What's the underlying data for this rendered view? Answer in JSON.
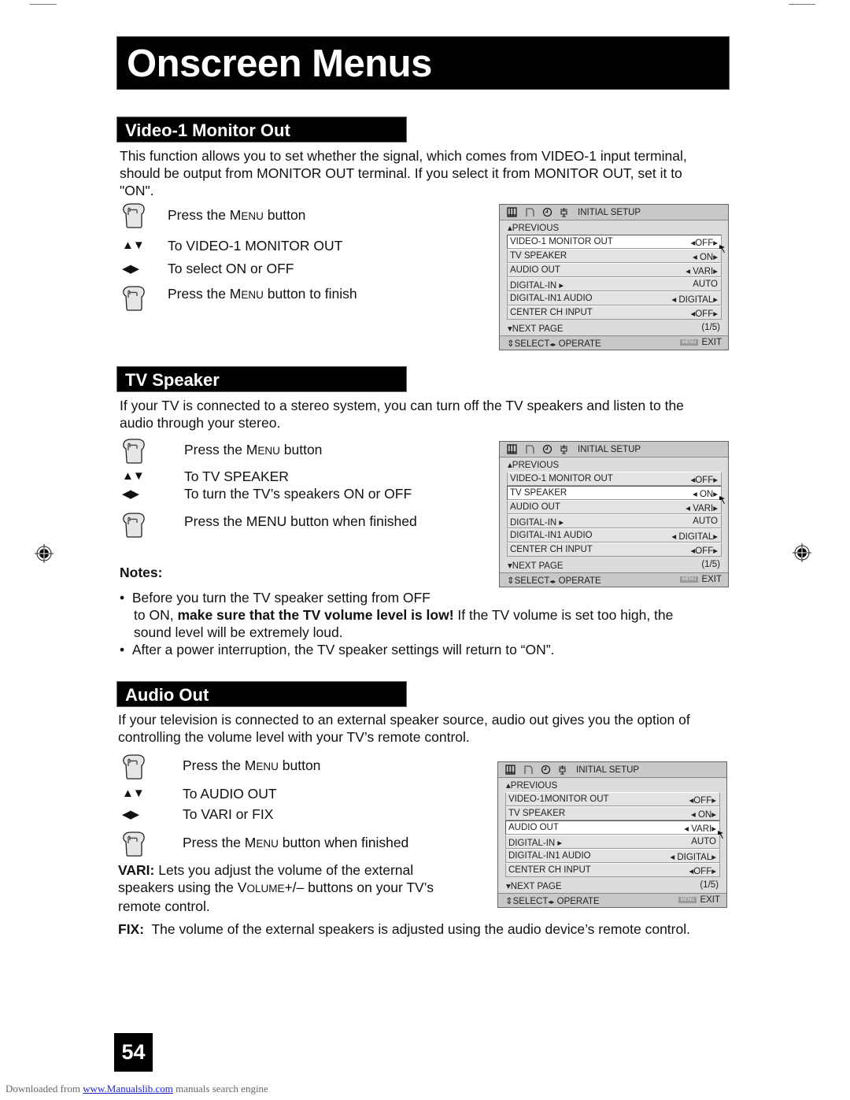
{
  "page_title": "Onscreen Menus",
  "page_number": "54",
  "footer": {
    "prefix": "Downloaded from ",
    "link_text": "www.Manualslib.com",
    "suffix": " manuals search engine"
  },
  "sections": [
    {
      "heading": "Video-1 Monitor Out",
      "intro_lines": [
        "This function allows you to set whether the signal, which comes from VIDEO-1 input terminal,",
        "should be output from MONITOR OUT terminal.  If you select it from MONITOR OUT, set it to",
        "\"ON\"."
      ],
      "steps": [
        {
          "icon": "hand-press-icon",
          "text_pre": "Press the M",
          "text_sc": "ENU",
          "text_post": " button"
        },
        {
          "icon": "up-down-arrows-icon",
          "text_pre": "To VIDEO-1 MONITOR OUT",
          "text_sc": "",
          "text_post": ""
        },
        {
          "icon": "left-right-arrows-icon",
          "text_pre": "To select ON or OFF",
          "text_sc": "",
          "text_post": ""
        },
        {
          "icon": "hand-press-icon",
          "text_pre": "Press the M",
          "text_sc": "ENU",
          "text_post": " button to finish"
        }
      ]
    },
    {
      "heading": "TV Speaker",
      "intro_lines": [
        "If your TV is connected to a stereo system, you can turn off the TV speakers and listen to the",
        "audio through your stereo."
      ],
      "steps": [
        {
          "icon": "hand-press-icon",
          "text_pre": "Press the M",
          "text_sc": "ENU",
          "text_post": " button"
        },
        {
          "icon": "up-down-arrows-icon",
          "text_pre": "To TV SPEAKER",
          "text_sc": "",
          "text_post": ""
        },
        {
          "icon": "left-right-arrows-icon",
          "text_pre": "To turn the TV’s speakers ON or OFF",
          "text_sc": "",
          "text_post": ""
        },
        {
          "icon": "hand-press-icon",
          "text_pre": "Press the MENU button when finished",
          "text_sc": "",
          "text_post": ""
        }
      ],
      "notes_label": "Notes:",
      "notes": [
        {
          "line1": "Before you turn the TV speaker setting from OFF",
          "line2_pre": "to ON, ",
          "line2_bold": "make sure that the TV volume level is low!",
          "line2_post": " If the TV volume is set too high, the",
          "line3": "sound level will be extremely loud."
        },
        {
          "line1": "After a power interruption, the TV speaker settings will return to “ON”."
        }
      ]
    },
    {
      "heading": "Audio Out",
      "intro_lines": [
        "If your television is connected to an external speaker source, audio out gives you the option of",
        "controlling the volume level with your TV’s remote control."
      ],
      "steps": [
        {
          "icon": "hand-press-icon",
          "text_pre": "Press the M",
          "text_sc": "ENU",
          "text_post": " button"
        },
        {
          "icon": "up-down-arrows-icon",
          "text_pre": "To AUDIO OUT",
          "text_sc": "",
          "text_post": ""
        },
        {
          "icon": "left-right-arrows-icon",
          "text_pre": "To VARI or FIX",
          "text_sc": "",
          "text_post": ""
        },
        {
          "icon": "hand-press-icon",
          "text_pre": "Press the M",
          "text_sc": "ENU",
          "text_post": " button when finished"
        }
      ],
      "vari": {
        "label": "VARI:",
        "line1": " Lets you adjust the volume of the external",
        "line2_pre": "speakers using the V",
        "line2_sc": "OLUME",
        "line2_post": "+/– buttons on your TV’s",
        "line3": "remote control."
      },
      "fix": {
        "label": "FIX:",
        "text": "  The volume of the external speakers is adjusted using the audio device’s remote control."
      }
    }
  ],
  "osd_menus": [
    {
      "title": "INITIAL SETUP",
      "previous": "PREVIOUS",
      "selected_index": 0,
      "items": [
        {
          "label": "VIDEO-1 MONITOR OUT",
          "value": "◂OFF▸"
        },
        {
          "label": "TV SPEAKER",
          "value": "◂ ON▸"
        },
        {
          "label": "AUDIO OUT",
          "value": "◂ VARI▸"
        },
        {
          "label": "DIGITAL-IN ▸",
          "value": "AUTO "
        },
        {
          "label": "DIGITAL-IN1 AUDIO",
          "value": "◂ DIGITAL▸"
        },
        {
          "label": "CENTER CH INPUT",
          "value": "◂OFF▸"
        }
      ],
      "next_page": "NEXT PAGE",
      "page_indicator": "(1/5)",
      "footer_select": "SELECT",
      "footer_operate": "OPERATE",
      "menu_badge": "MENU",
      "footer_exit": "EXIT"
    },
    {
      "title": "INITIAL SETUP",
      "previous": "PREVIOUS",
      "selected_index": 1,
      "items": [
        {
          "label": "VIDEO-1 MONITOR OUT",
          "value": "◂OFF▸"
        },
        {
          "label": "TV SPEAKER",
          "value": "◂ ON▸"
        },
        {
          "label": "AUDIO OUT",
          "value": "◂ VARI▸"
        },
        {
          "label": "DIGITAL-IN ▸",
          "value": "AUTO "
        },
        {
          "label": "DIGITAL-IN1 AUDIO",
          "value": "◂ DIGITAL▸"
        },
        {
          "label": "CENTER CH INPUT",
          "value": "◂OFF▸"
        }
      ],
      "next_page": "NEXT PAGE",
      "page_indicator": "(1/5)",
      "footer_select": "SELECT",
      "footer_operate": "OPERATE",
      "menu_badge": "MENU",
      "footer_exit": "EXIT"
    },
    {
      "title": "INITIAL SETUP",
      "previous": "PREVIOUS",
      "selected_index": 2,
      "items": [
        {
          "label": "VIDEO-1MONITOR OUT",
          "value": "◂OFF▸"
        },
        {
          "label": "TV SPEAKER",
          "value": "◂ ON▸"
        },
        {
          "label": "AUDIO OUT",
          "value": "◂ VARI▸"
        },
        {
          "label": "DIGITAL-IN ▸",
          "value": "AUTO "
        },
        {
          "label": "DIGITAL-IN1 AUDIO",
          "value": "◂ DIGITAL▸"
        },
        {
          "label": "CENTER CH INPUT",
          "value": "◂OFF▸"
        }
      ],
      "next_page": "NEXT PAGE",
      "page_indicator": "(1/5)",
      "footer_select": "SELECT",
      "footer_operate": "OPERATE",
      "menu_badge": "MENU",
      "footer_exit": "EXIT"
    }
  ]
}
